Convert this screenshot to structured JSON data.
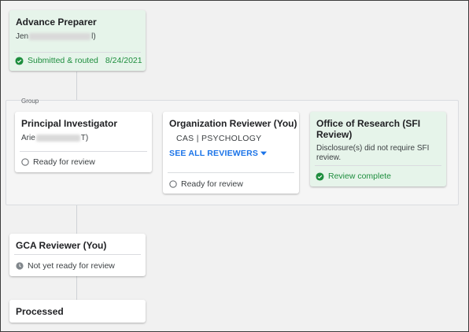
{
  "advance_preparer": {
    "title": "Advance Preparer",
    "name_prefix": "Jen",
    "name_suffix": "l)",
    "status_label": "Submitted & routed",
    "status_date": "8/24/2021"
  },
  "group": {
    "label": "Group",
    "principal_investigator": {
      "title": "Principal Investigator",
      "name_prefix": "Arie",
      "name_suffix": "T)",
      "status_label": "Ready for review"
    },
    "organization_reviewer": {
      "title": "Organization Reviewer (You)",
      "department": "CAS | PSYCHOLOGY",
      "see_all_label": "SEE ALL REVIEWERS",
      "status_label": "Ready for review"
    },
    "office_of_research": {
      "title": "Office of Research (SFI Review)",
      "note": "Disclosure(s) did not require SFI review.",
      "status_label": "Review complete"
    }
  },
  "gca_reviewer": {
    "title": "GCA Reviewer (You)",
    "status_label": "Not yet ready for review"
  },
  "processed": {
    "title": "Processed"
  },
  "colors": {
    "complete_bg": "#e6f4ea",
    "complete_text": "#1e8e3e",
    "link": "#1a73e8"
  }
}
